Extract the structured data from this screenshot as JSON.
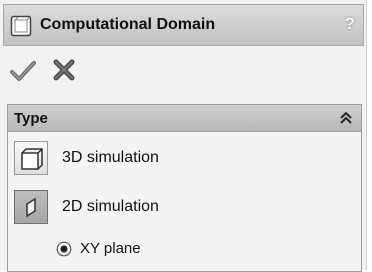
{
  "dialog": {
    "title": "Computational Domain",
    "help_symbol": "?",
    "ok_icon": "checkmark-icon",
    "cancel_icon": "x-icon"
  },
  "type_group": {
    "title": "Type",
    "collapse_icon": "double-chevron-up-icon",
    "options": [
      {
        "label": "3D simulation",
        "icon": "cube-icon",
        "selected": false
      },
      {
        "label": "2D simulation",
        "icon": "plane-icon",
        "selected": true
      }
    ],
    "plane": {
      "label": "XY plane",
      "selected": true
    }
  }
}
